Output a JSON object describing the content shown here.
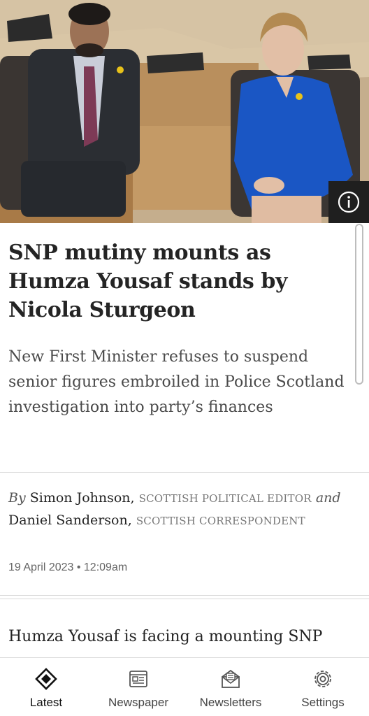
{
  "article": {
    "image_alt": "Humza Yousaf and Nicola Sturgeon seated in the Scottish Parliament chamber",
    "info_icon": "info-icon",
    "headline": "SNP mutiny mounts as Humza Yousaf stands by Nicola Sturgeon",
    "standfirst": "New First Minister refuses to suspend senior figures embroiled in Police Scotland investigation into party’s finances",
    "byline": {
      "by": "By",
      "author1": "Simon Johnson,",
      "role1": "Scottish Political Editor",
      "and": "and",
      "author2": "Daniel Sanderson,",
      "role2": "Scottish Correspondent"
    },
    "date": "19 April 2023 • 12:09am",
    "body_start": "Humza Yousaf is facing a mounting SNP"
  },
  "nav": {
    "items": [
      {
        "label": "Latest",
        "icon": "latest-diamond-icon"
      },
      {
        "label": "Newspaper",
        "icon": "newspaper-icon"
      },
      {
        "label": "Newsletters",
        "icon": "newsletters-icon"
      },
      {
        "label": "Settings",
        "icon": "gear-icon"
      }
    ]
  },
  "colors": {
    "hero_navy": "#1a56c4",
    "text_dark": "#242424",
    "text_muted": "#777777"
  }
}
